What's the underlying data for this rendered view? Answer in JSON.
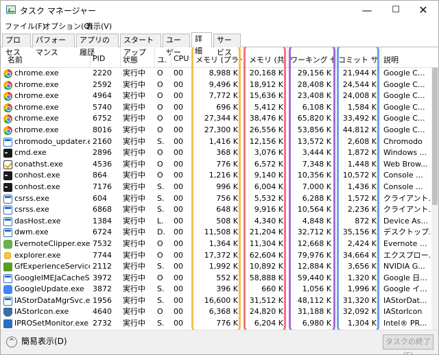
{
  "window": {
    "title": "タスク マネージャー",
    "minimize": "—",
    "maximize": "☐",
    "close": "✕"
  },
  "menu": [
    "ファイル(F)",
    "オプション(O)",
    "表示(V)"
  ],
  "tabs": [
    "プロセス",
    "パフォーマンス",
    "アプリの履歴",
    "スタートアップ",
    "ユーザー",
    "詳細",
    "サービス"
  ],
  "selected_tab": "詳細",
  "columns": [
    "名前",
    "PID",
    "状態",
    "ユ.",
    "CPU",
    "メモリ (プライ...",
    "メモリ (共...",
    "ワーキング セ...",
    "コミット サイズ",
    "説明"
  ],
  "rows": [
    {
      "icon": "chrome",
      "name": "chrome.exe",
      "pid": "2220",
      "status": "実行中",
      "user": "O",
      "cpu": "00",
      "mem": "8,988 K",
      "shared": "20,168 K",
      "ws": "29,156 K",
      "commit": "21,944 K",
      "desc": "Google C..."
    },
    {
      "icon": "chrome",
      "name": "chrome.exe",
      "pid": "2592",
      "status": "実行中",
      "user": "O",
      "cpu": "00",
      "mem": "9,496 K",
      "shared": "18,912 K",
      "ws": "28,408 K",
      "commit": "24,544 K",
      "desc": "Google C..."
    },
    {
      "icon": "chrome",
      "name": "chrome.exe",
      "pid": "4964",
      "status": "実行中",
      "user": "O",
      "cpu": "00",
      "mem": "7,772 K",
      "shared": "15,636 K",
      "ws": "23,408 K",
      "commit": "24,008 K",
      "desc": "Google C..."
    },
    {
      "icon": "chrome",
      "name": "chrome.exe",
      "pid": "5740",
      "status": "実行中",
      "user": "O",
      "cpu": "00",
      "mem": "696 K",
      "shared": "5,412 K",
      "ws": "6,108 K",
      "commit": "1,584 K",
      "desc": "Google C..."
    },
    {
      "icon": "chrome",
      "name": "chrome.exe",
      "pid": "6752",
      "status": "実行中",
      "user": "O",
      "cpu": "00",
      "mem": "27,344 K",
      "shared": "38,476 K",
      "ws": "65,820 K",
      "commit": "33,492 K",
      "desc": "Google C..."
    },
    {
      "icon": "chrome",
      "name": "chrome.exe",
      "pid": "8016",
      "status": "実行中",
      "user": "O",
      "cpu": "00",
      "mem": "27,300 K",
      "shared": "26,556 K",
      "ws": "53,856 K",
      "commit": "44,812 K",
      "desc": "Google C..."
    },
    {
      "icon": "win",
      "name": "chromodo_updater.e...",
      "pid": "2160",
      "status": "実行中",
      "user": "S.",
      "cpu": "00",
      "mem": "1,416 K",
      "shared": "12,156 K",
      "ws": "13,572 K",
      "commit": "2,608 K",
      "desc": "Chromodo"
    },
    {
      "icon": "cmd",
      "name": "cmd.exe",
      "pid": "2896",
      "status": "実行中",
      "user": "O",
      "cpu": "00",
      "mem": "368 K",
      "shared": "3,076 K",
      "ws": "3,444 K",
      "commit": "1,872 K",
      "desc": "Windows ..."
    },
    {
      "icon": "check",
      "name": "conathst.exe",
      "pid": "4536",
      "status": "実行中",
      "user": "O",
      "cpu": "00",
      "mem": "776 K",
      "shared": "6,572 K",
      "ws": "7,348 K",
      "commit": "1,448 K",
      "desc": "Web Brow..."
    },
    {
      "icon": "cmd",
      "name": "conhost.exe",
      "pid": "864",
      "status": "実行中",
      "user": "O",
      "cpu": "00",
      "mem": "1,216 K",
      "shared": "9,140 K",
      "ws": "10,356 K",
      "commit": "10,572 K",
      "desc": "Console ..."
    },
    {
      "icon": "cmd",
      "name": "conhost.exe",
      "pid": "7176",
      "status": "実行中",
      "user": "S.",
      "cpu": "00",
      "mem": "996 K",
      "shared": "6,004 K",
      "ws": "7,000 K",
      "commit": "1,436 K",
      "desc": "Console ..."
    },
    {
      "icon": "win",
      "name": "csrss.exe",
      "pid": "604",
      "status": "実行中",
      "user": "S.",
      "cpu": "00",
      "mem": "756 K",
      "shared": "5,532 K",
      "ws": "6,288 K",
      "commit": "1,572 K",
      "desc": "クライアント..."
    },
    {
      "icon": "win",
      "name": "csrss.exe",
      "pid": "6868",
      "status": "実行中",
      "user": "S.",
      "cpu": "00",
      "mem": "648 K",
      "shared": "9,916 K",
      "ws": "10,564 K",
      "commit": "2,236 K",
      "desc": "クライアント..."
    },
    {
      "icon": "win",
      "name": "dasHost.exe",
      "pid": "1384",
      "status": "実行中",
      "user": "L.",
      "cpu": "00",
      "mem": "508 K",
      "shared": "4,340 K",
      "ws": "4,848 K",
      "commit": "872 K",
      "desc": "Device As..."
    },
    {
      "icon": "win",
      "name": "dwm.exe",
      "pid": "6724",
      "status": "実行中",
      "user": "D.",
      "cpu": "00",
      "mem": "11,508 K",
      "shared": "21,204 K",
      "ws": "32,712 K",
      "commit": "35,156 K",
      "desc": "デスクトップ..."
    },
    {
      "icon": "green",
      "name": "EvernoteClipper.exe",
      "pid": "7532",
      "status": "実行中",
      "user": "O",
      "cpu": "00",
      "mem": "1,364 K",
      "shared": "11,304 K",
      "ws": "12,668 K",
      "commit": "2,424 K",
      "desc": "Evernote ..."
    },
    {
      "icon": "ie",
      "name": "explorer.exe",
      "pid": "7744",
      "status": "実行中",
      "user": "O",
      "cpu": "00",
      "mem": "17,372 K",
      "shared": "62,604 K",
      "ws": "79,976 K",
      "commit": "34,664 K",
      "desc": "エクスプロー..."
    },
    {
      "icon": "nvidia",
      "name": "GfExperienceService....",
      "pid": "2112",
      "status": "実行中",
      "user": "S.",
      "cpu": "00",
      "mem": "1,992 K",
      "shared": "10,892 K",
      "ws": "12,884 K",
      "commit": "3,656 K",
      "desc": "NVIDIA G..."
    },
    {
      "icon": "win",
      "name": "GoogleIMEJaCacheS...",
      "pid": "3972",
      "status": "実行中",
      "user": "O",
      "cpu": "00",
      "mem": "552 K",
      "shared": "58,888 K",
      "ws": "59,440 K",
      "commit": "1,320 K",
      "desc": "Google 日..."
    },
    {
      "icon": "gupd",
      "name": "GoogleUpdate.exe",
      "pid": "3872",
      "status": "実行中",
      "user": "S.",
      "cpu": "00",
      "mem": "396 K",
      "shared": "660 K",
      "ws": "1,056 K",
      "commit": "1,996 K",
      "desc": "Google イ..."
    },
    {
      "icon": "win",
      "name": "IAStorDataMgrSvc.exe",
      "pid": "1956",
      "status": "実行中",
      "user": "S.",
      "cpu": "00",
      "mem": "16,600 K",
      "shared": "31,512 K",
      "ws": "48,112 K",
      "commit": "31,320 K",
      "desc": "IAStorDat..."
    },
    {
      "icon": "shield",
      "name": "IAStorIcon.exe",
      "pid": "4640",
      "status": "実行中",
      "user": "O",
      "cpu": "00",
      "mem": "6,368 K",
      "shared": "24,820 K",
      "ws": "31,188 K",
      "commit": "32,092 K",
      "desc": "IAStorIcon"
    },
    {
      "icon": "blue",
      "name": "IPROSetMonitor.exe",
      "pid": "2732",
      "status": "実行中",
      "user": "S.",
      "cpu": "00",
      "mem": "776 K",
      "shared": "6,204 K",
      "ws": "6,980 K",
      "commit": "1,304 K",
      "desc": "Intel® PR..."
    }
  ],
  "highlights": {
    "memory_private": "#f5c04a",
    "memory_shared": "#f0727f",
    "working_set": "#a46bd6",
    "commit_size": "#6e9ef0"
  },
  "footer": {
    "fewer_details": "簡易表示(D)",
    "end_task": "タスクの終了(E)"
  }
}
